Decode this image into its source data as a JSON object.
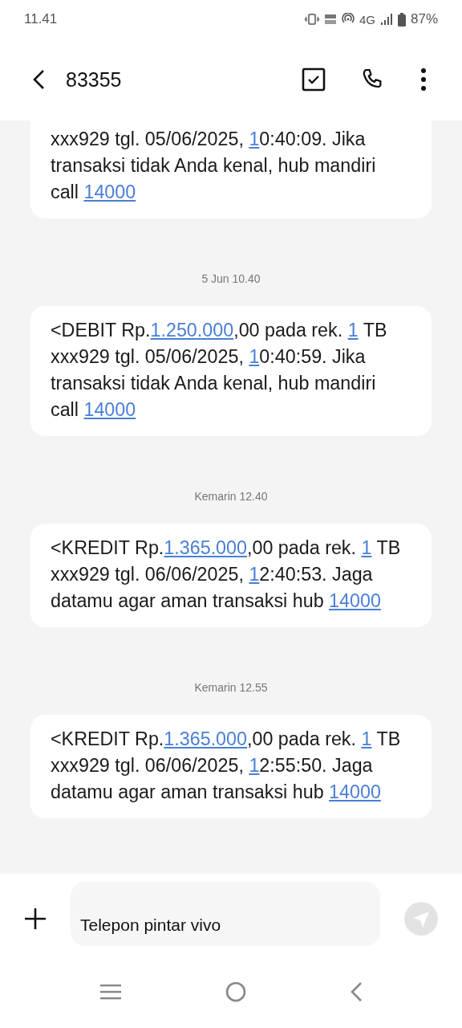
{
  "status_bar": {
    "time": "11.41",
    "network": "4G",
    "battery": "87%"
  },
  "header": {
    "title": "83355"
  },
  "messages": [
    {
      "kind": "message",
      "cut_top": true,
      "parts": [
        {
          "kind": "text",
          "text": "xxx929 tgl. 05/06/2025,  "
        },
        {
          "kind": "link",
          "text": "1"
        },
        {
          "kind": "text",
          "text": "0:40:09. Jika transaksi tidak Anda kenal, hub mandiri call "
        },
        {
          "kind": "link",
          "text": "14000"
        }
      ]
    },
    {
      "kind": "time",
      "text": "5 Jun 10.40"
    },
    {
      "kind": "message",
      "cut_top": false,
      "parts": [
        {
          "kind": "text",
          "text": "<DEBIT Rp."
        },
        {
          "kind": "link",
          "text": "1.250.000"
        },
        {
          "kind": "text",
          "text": ",00 pada rek. "
        },
        {
          "kind": "link",
          "text": "1"
        },
        {
          "kind": "text",
          "text": " TB xxx929 tgl. 05/06/2025,  "
        },
        {
          "kind": "link",
          "text": "1"
        },
        {
          "kind": "text",
          "text": "0:40:59. Jika transaksi tidak Anda kenal, hub mandiri call "
        },
        {
          "kind": "link",
          "text": "14000"
        }
      ]
    },
    {
      "kind": "time",
      "text": "Kemarin 12.40"
    },
    {
      "kind": "message",
      "cut_top": false,
      "parts": [
        {
          "kind": "text",
          "text": "<KREDIT Rp."
        },
        {
          "kind": "link",
          "text": "1.365.000"
        },
        {
          "kind": "text",
          "text": ",00 pada rek. "
        },
        {
          "kind": "link",
          "text": "1"
        },
        {
          "kind": "text",
          "text": " TB xxx929 tgl. 06/06/2025,  "
        },
        {
          "kind": "link",
          "text": "1"
        },
        {
          "kind": "text",
          "text": "2:40:53. Jaga datamu agar aman transaksi hub "
        },
        {
          "kind": "link",
          "text": "14000"
        }
      ]
    },
    {
      "kind": "time",
      "text": "Kemarin 12.55"
    },
    {
      "kind": "message",
      "cut_top": false,
      "parts": [
        {
          "kind": "text",
          "text": "<KREDIT Rp."
        },
        {
          "kind": "link",
          "text": "1.365.000"
        },
        {
          "kind": "text",
          "text": ",00 pada rek. "
        },
        {
          "kind": "link",
          "text": "1"
        },
        {
          "kind": "text",
          "text": " TB xxx929 tgl. 06/06/2025,  "
        },
        {
          "kind": "link",
          "text": "1"
        },
        {
          "kind": "text",
          "text": "2:55:50. Jaga datamu agar aman transaksi hub "
        },
        {
          "kind": "link",
          "text": "14000"
        }
      ]
    }
  ],
  "composer": {
    "value": "Telepon pintar vivo"
  }
}
